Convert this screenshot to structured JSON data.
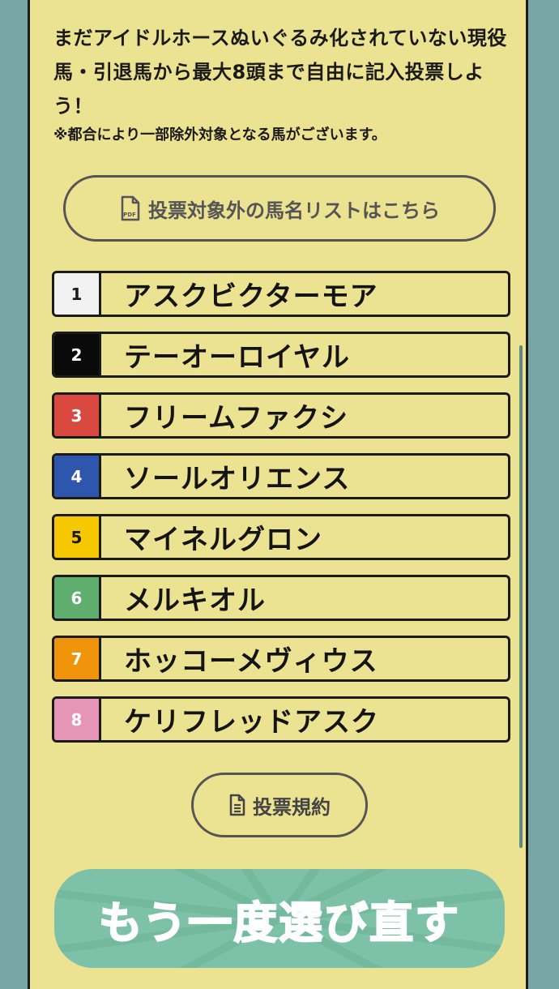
{
  "intro": {
    "main_text": "まだアイドルホースぬいぐるみ化されていない現役馬・引退馬から最大8頭まで自由に記入投票しよう！",
    "note_text": "※都合により一部除外対象となる馬がございます。"
  },
  "pdf_button": {
    "label": "投票対象外の馬名リストはこちら",
    "icon": "pdf-file-icon"
  },
  "horses": [
    {
      "number": "1",
      "name": "アスクビクターモア",
      "color": "#f2f2f2",
      "text_color": "#1b1b1b"
    },
    {
      "number": "2",
      "name": "テーオーロイヤル",
      "color": "#0a0a0a",
      "text_color": "#ffffff"
    },
    {
      "number": "3",
      "name": "フリームファクシ",
      "color": "#d9493f",
      "text_color": "#ffffff"
    },
    {
      "number": "4",
      "name": "ソールオリエンス",
      "color": "#2f56ad",
      "text_color": "#ffffff"
    },
    {
      "number": "5",
      "name": "マイネルグロン",
      "color": "#f6c800",
      "text_color": "#1b1b1b"
    },
    {
      "number": "6",
      "name": "メルキオル",
      "color": "#5fae6e",
      "text_color": "#ffffff"
    },
    {
      "number": "7",
      "name": "ホッコーメヴィウス",
      "color": "#f0940b",
      "text_color": "#ffffff"
    },
    {
      "number": "8",
      "name": "ケリフレッドアスク",
      "color": "#e695b8",
      "text_color": "#ffffff"
    }
  ],
  "terms_button": {
    "label": "投票規約",
    "icon": "document-icon"
  },
  "redo_button": {
    "label": "もう一度選び直す"
  },
  "colors": {
    "background": "#7aa5a6",
    "panel": "#ebe292",
    "redo_button": "#7dc2a8"
  }
}
